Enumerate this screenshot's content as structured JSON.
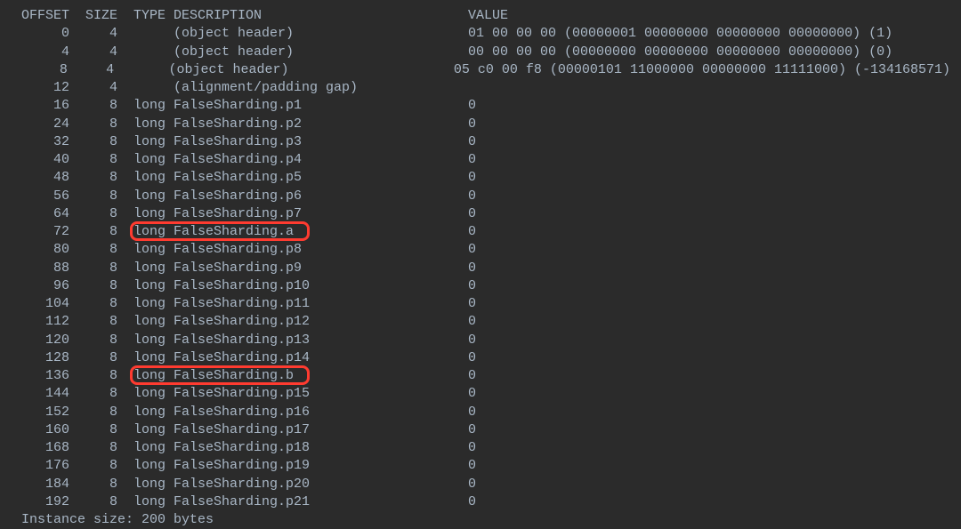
{
  "headers": {
    "offset": "OFFSET",
    "size": "SIZE",
    "type": "TYPE",
    "description": "DESCRIPTION",
    "value": "VALUE"
  },
  "rows": [
    {
      "offset": "0",
      "size": "4",
      "type": "",
      "description": "(object header)",
      "value": "01 00 00 00 (00000001 00000000 00000000 00000000) (1)"
    },
    {
      "offset": "4",
      "size": "4",
      "type": "",
      "description": "(object header)",
      "value": "00 00 00 00 (00000000 00000000 00000000 00000000) (0)"
    },
    {
      "offset": "8",
      "size": "4",
      "type": "",
      "description": "(object header)",
      "value": "05 c0 00 f8 (00000101 11000000 00000000 11111000) (-134168571)"
    },
    {
      "offset": "12",
      "size": "4",
      "type": "",
      "description": "(alignment/padding gap)",
      "value": ""
    },
    {
      "offset": "16",
      "size": "8",
      "type": "long",
      "description": "FalseSharding.p1",
      "value": "0"
    },
    {
      "offset": "24",
      "size": "8",
      "type": "long",
      "description": "FalseSharding.p2",
      "value": "0"
    },
    {
      "offset": "32",
      "size": "8",
      "type": "long",
      "description": "FalseSharding.p3",
      "value": "0"
    },
    {
      "offset": "40",
      "size": "8",
      "type": "long",
      "description": "FalseSharding.p4",
      "value": "0"
    },
    {
      "offset": "48",
      "size": "8",
      "type": "long",
      "description": "FalseSharding.p5",
      "value": "0"
    },
    {
      "offset": "56",
      "size": "8",
      "type": "long",
      "description": "FalseSharding.p6",
      "value": "0"
    },
    {
      "offset": "64",
      "size": "8",
      "type": "long",
      "description": "FalseSharding.p7",
      "value": "0"
    },
    {
      "offset": "72",
      "size": "8",
      "type": "long",
      "description": "FalseSharding.a",
      "value": "0",
      "highlighted": true
    },
    {
      "offset": "80",
      "size": "8",
      "type": "long",
      "description": "FalseSharding.p8",
      "value": "0"
    },
    {
      "offset": "88",
      "size": "8",
      "type": "long",
      "description": "FalseSharding.p9",
      "value": "0"
    },
    {
      "offset": "96",
      "size": "8",
      "type": "long",
      "description": "FalseSharding.p10",
      "value": "0"
    },
    {
      "offset": "104",
      "size": "8",
      "type": "long",
      "description": "FalseSharding.p11",
      "value": "0"
    },
    {
      "offset": "112",
      "size": "8",
      "type": "long",
      "description": "FalseSharding.p12",
      "value": "0"
    },
    {
      "offset": "120",
      "size": "8",
      "type": "long",
      "description": "FalseSharding.p13",
      "value": "0"
    },
    {
      "offset": "128",
      "size": "8",
      "type": "long",
      "description": "FalseSharding.p14",
      "value": "0"
    },
    {
      "offset": "136",
      "size": "8",
      "type": "long",
      "description": "FalseSharding.b",
      "value": "0",
      "highlighted": true
    },
    {
      "offset": "144",
      "size": "8",
      "type": "long",
      "description": "FalseSharding.p15",
      "value": "0"
    },
    {
      "offset": "152",
      "size": "8",
      "type": "long",
      "description": "FalseSharding.p16",
      "value": "0"
    },
    {
      "offset": "160",
      "size": "8",
      "type": "long",
      "description": "FalseSharding.p17",
      "value": "0"
    },
    {
      "offset": "168",
      "size": "8",
      "type": "long",
      "description": "FalseSharding.p18",
      "value": "0"
    },
    {
      "offset": "176",
      "size": "8",
      "type": "long",
      "description": "FalseSharding.p19",
      "value": "0"
    },
    {
      "offset": "184",
      "size": "8",
      "type": "long",
      "description": "FalseSharding.p20",
      "value": "0"
    },
    {
      "offset": "192",
      "size": "8",
      "type": "long",
      "description": "FalseSharding.p21",
      "value": "0"
    }
  ],
  "footer": "Instance size: 200 bytes"
}
